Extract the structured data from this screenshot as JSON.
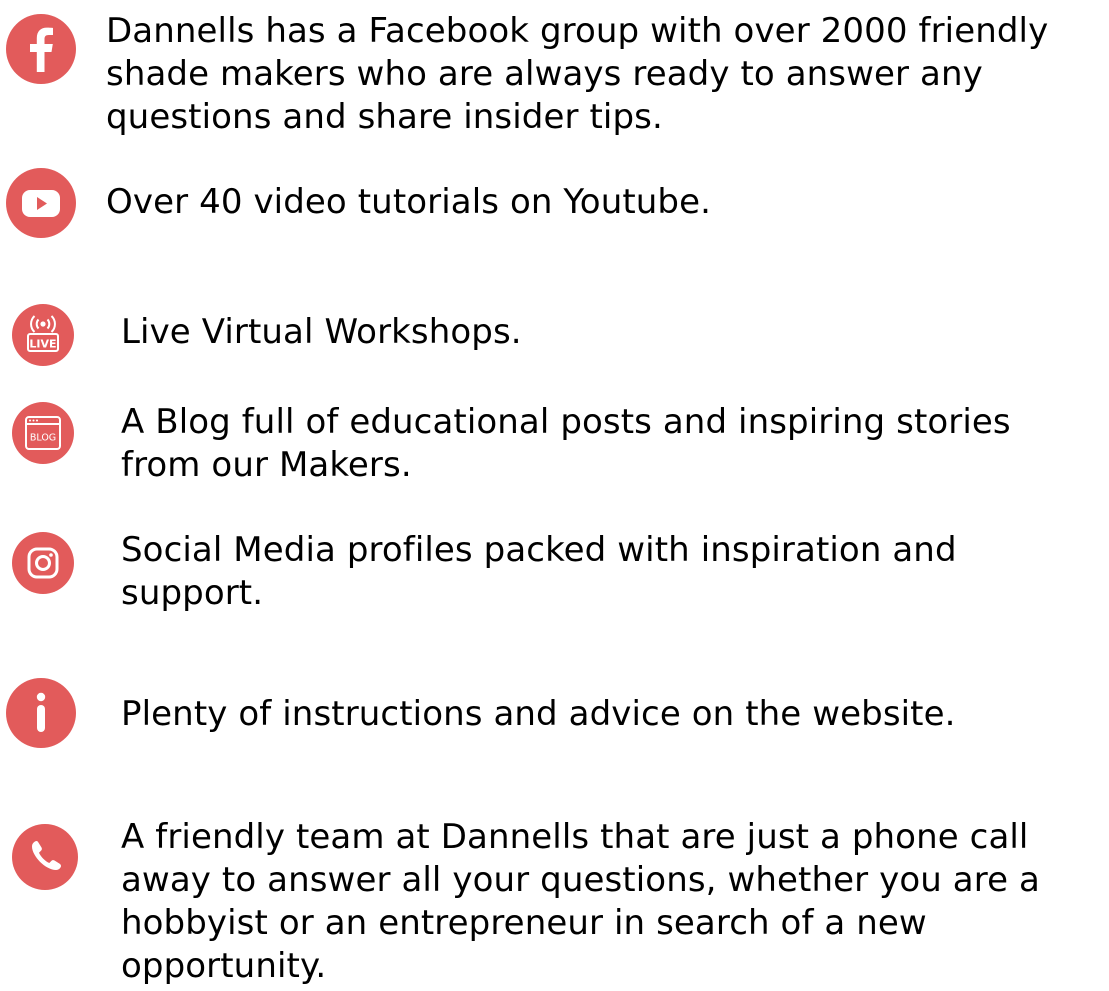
{
  "colors": {
    "icon_bg": "#e25b5b",
    "icon_fg": "#ffffff",
    "text": "#000000"
  },
  "items": [
    {
      "icon": "facebook-icon",
      "lines": [
        "Dannells has a Facebook group with over 2000 friendly",
        "shade makers who are always ready to answer any",
        "questions and share insider tips."
      ]
    },
    {
      "icon": "youtube-icon",
      "lines": [
        "Over 40 video tutorials on Youtube."
      ]
    },
    {
      "icon": "live-icon",
      "icon_text": "LIVE",
      "lines": [
        "Live Virtual Workshops."
      ]
    },
    {
      "icon": "blog-icon",
      "icon_text": "BLOG",
      "lines": [
        "A Blog full of educational posts and inspiring stories",
        "from our Makers."
      ]
    },
    {
      "icon": "instagram-icon",
      "lines": [
        "Social Media profiles packed with inspiration and",
        "support."
      ]
    },
    {
      "icon": "info-icon",
      "lines": [
        "Plenty of instructions and advice on the website."
      ]
    },
    {
      "icon": "phone-icon",
      "lines": [
        "A friendly team at Dannells that are just a phone call",
        "away to answer all your questions, whether you are a",
        "hobbyist or an entrepreneur in search of a new",
        "opportunity."
      ]
    }
  ]
}
